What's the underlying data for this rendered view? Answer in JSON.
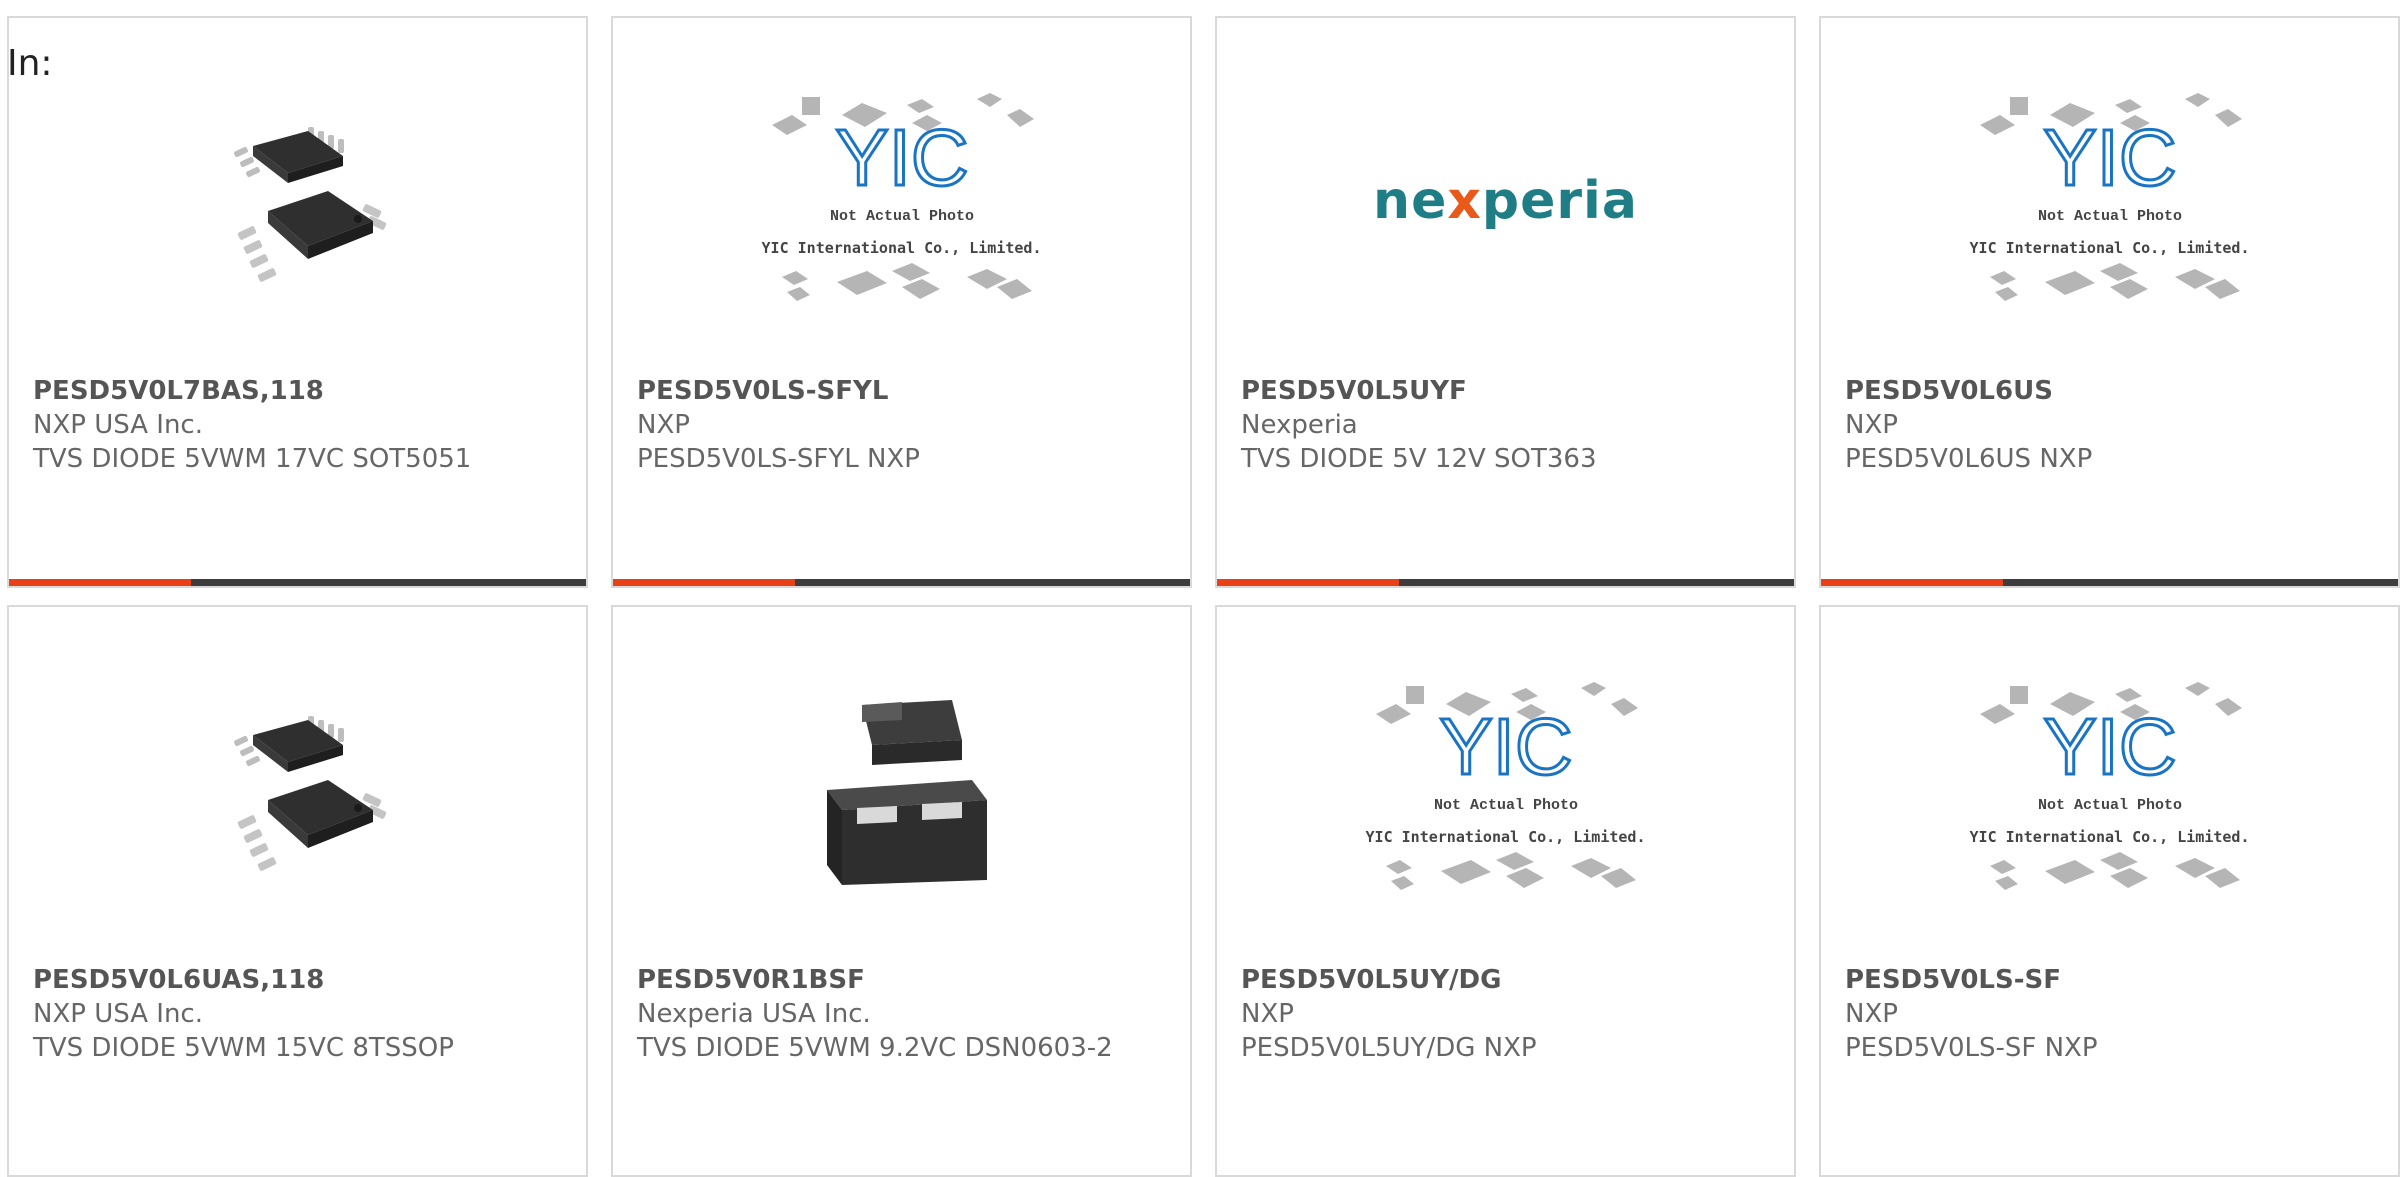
{
  "header": {
    "label": "In:"
  },
  "theme": {
    "accent": "#e84118",
    "bar": "#3d3d3d",
    "logo_blue": "#1f7d86",
    "logo_orange": "#e8591a",
    "yic_blue": "#1a74c4"
  },
  "products": [
    {
      "part_number": "PESD5V0L7BAS,118",
      "manufacturer": "NXP USA Inc.",
      "description": "TVS DIODE 5VWM 17VC SOT5051",
      "image": "msop-8-package"
    },
    {
      "part_number": "PESD5V0LS-SFYL",
      "manufacturer": "NXP",
      "description": "PESD5V0LS-SFYL NXP",
      "image": "yic-placeholder",
      "image_text": [
        "Not Actual Photo",
        "YIC International Co., Limited."
      ]
    },
    {
      "part_number": "PESD5V0L5UYF",
      "manufacturer": "Nexperia",
      "description": "TVS DIODE 5V 12V SOT363",
      "image": "nexperia-logo",
      "image_text": [
        "ne",
        "x",
        "peria"
      ]
    },
    {
      "part_number": "PESD5V0L6US",
      "manufacturer": "NXP",
      "description": "PESD5V0L6US NXP",
      "image": "yic-placeholder",
      "image_text": [
        "Not Actual Photo",
        "YIC International Co., Limited."
      ]
    },
    {
      "part_number": "PESD5V0L6UAS,118",
      "manufacturer": "NXP USA Inc.",
      "description": "TVS DIODE 5VWM 15VC 8TSSOP",
      "image": "msop-8-package"
    },
    {
      "part_number": "PESD5V0R1BSF",
      "manufacturer": "Nexperia USA Inc.",
      "description": "TVS DIODE 5VWM 9.2VC DSN0603-2",
      "image": "dsn-package"
    },
    {
      "part_number": "PESD5V0L5UY/DG",
      "manufacturer": "NXP",
      "description": "PESD5V0L5UY/DG NXP",
      "image": "yic-placeholder",
      "image_text": [
        "Not Actual Photo",
        "YIC International Co., Limited."
      ]
    },
    {
      "part_number": "PESD5V0LS-SF",
      "manufacturer": "NXP",
      "description": "PESD5V0LS-SF NXP",
      "image": "yic-placeholder",
      "image_text": [
        "Not Actual Photo",
        "YIC International Co., Limited."
      ]
    }
  ]
}
